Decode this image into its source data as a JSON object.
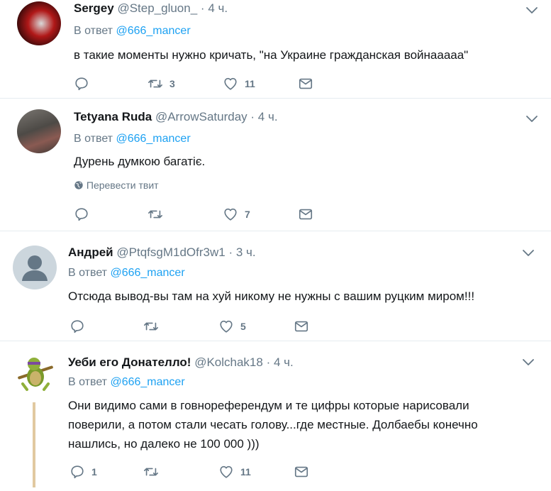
{
  "tweets": [
    {
      "name": "Sergey",
      "handle": "@Step_gluon_",
      "dot": "·",
      "time": "4 ч.",
      "reply_prefix": "В ответ",
      "reply_to": "@666_mancer",
      "text": "в такие моменты нужно кричать, \"на Украине гражданская войнааааа\"",
      "reply_count": "",
      "retweet_count": "3",
      "like_count": "11"
    },
    {
      "name": "Tetyana Ruda",
      "handle": "@ArrowSaturday",
      "dot": "·",
      "time": "4 ч.",
      "reply_prefix": "В ответ",
      "reply_to": "@666_mancer",
      "text": "Дурень думкою багатіє.",
      "translate": "Перевести твит",
      "reply_count": "",
      "retweet_count": "",
      "like_count": "7"
    },
    {
      "name": "Андрей",
      "handle": "@PtqfsgM1dOfr3w1",
      "dot": "·",
      "time": "3 ч.",
      "reply_prefix": "В ответ",
      "reply_to": "@666_mancer",
      "text": "Отсюда вывод-вы там на хуй никому не нужны с вашим руцким миром!!!",
      "reply_count": "",
      "retweet_count": "",
      "like_count": "5"
    },
    {
      "name": "Уеби его Донателло!",
      "handle": "@Kolchak18",
      "dot": "·",
      "time": "4 ч.",
      "reply_prefix": "В ответ",
      "reply_to": "@666_mancer",
      "text_lines": [
        "Они видимо сами в говнореферендум и те цифры которые нарисовали",
        "поверили, а потом стали чесать голову...где местные. Долбаебы конечно",
        "нашлись, но далеко не 100 000 )))"
      ],
      "reply_count": "1",
      "retweet_count": "",
      "like_count": "11"
    }
  ],
  "icons": {
    "reply": "reply-icon",
    "retweet": "retweet-icon",
    "like": "heart-icon",
    "dm": "envelope-icon",
    "more": "chevron-down-icon",
    "globe": "globe-icon"
  },
  "colors": {
    "link": "#1da1f2",
    "muted": "#657786",
    "text": "#14171a",
    "divider": "#e6ecf0"
  }
}
